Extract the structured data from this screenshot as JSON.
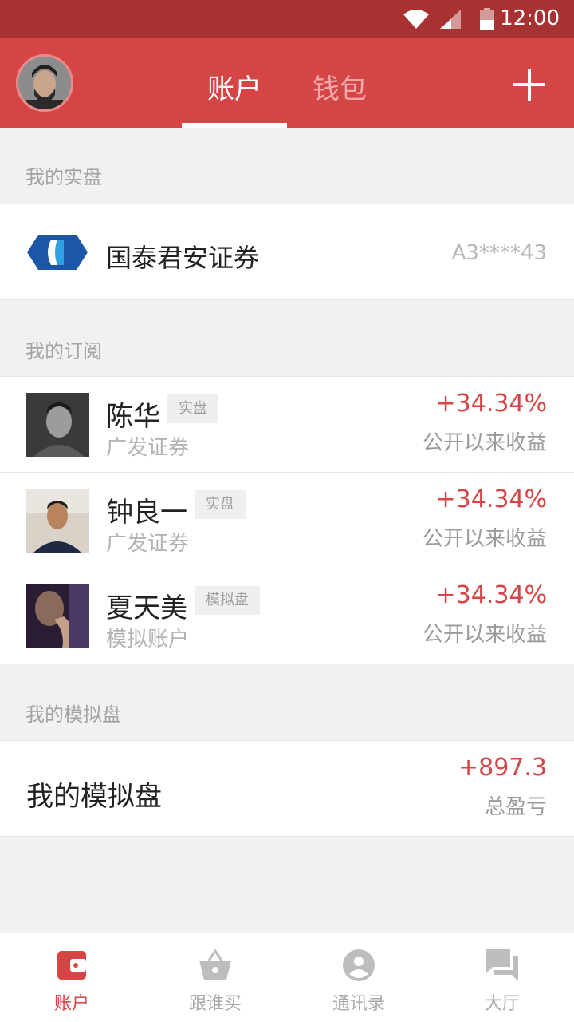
{
  "status_bar": {
    "time": "12:00"
  },
  "header": {
    "tabs": [
      {
        "label": "账户",
        "active": true
      },
      {
        "label": "钱包",
        "active": false
      }
    ],
    "add_icon": "plus-icon"
  },
  "sections": {
    "real": {
      "title": "我的实盘"
    },
    "subscriptions": {
      "title": "我的订阅"
    },
    "simulated": {
      "title": "我的模拟盘"
    }
  },
  "broker": {
    "name": "国泰君安证券",
    "account": "A3****43"
  },
  "subscriptions": [
    {
      "name": "陈华",
      "tag": "实盘",
      "broker": "广发证券",
      "return": "+34.34%",
      "return_label": "公开以来收益"
    },
    {
      "name": "钟良一",
      "tag": "实盘",
      "broker": "广发证券",
      "return": "+34.34%",
      "return_label": "公开以来收益"
    },
    {
      "name": "夏天美",
      "tag": "模拟盘",
      "broker": "模拟账户",
      "return": "+34.34%",
      "return_label": "公开以来收益"
    }
  ],
  "simulated": {
    "name": "我的模拟盘",
    "value": "+897.3",
    "label": "总盈亏"
  },
  "bottom_nav": [
    {
      "label": "账户",
      "icon": "wallet-icon",
      "active": true
    },
    {
      "label": "跟谁买",
      "icon": "basket-icon",
      "active": false
    },
    {
      "label": "通讯录",
      "icon": "contact-icon",
      "active": false
    },
    {
      "label": "大厅",
      "icon": "chat-icon",
      "active": false
    }
  ],
  "colors": {
    "brand": "#d64545",
    "status_bar": "#a83232",
    "background": "#f1f1f1"
  }
}
